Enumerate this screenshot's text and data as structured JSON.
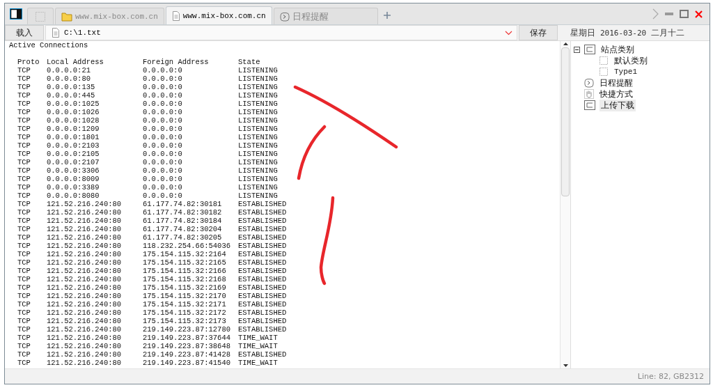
{
  "tabs": [
    {
      "kind": "blank",
      "selected": false
    },
    {
      "kind": "folder",
      "label": "www.mix-box.com.cn",
      "selected": false
    },
    {
      "kind": "document",
      "label": "www.mix-box.com.cn",
      "selected": true
    },
    {
      "kind": "clock",
      "label": "日程提醒",
      "selected": false
    }
  ],
  "toolbar": {
    "load_button": "载入",
    "path_value": "C:\\1.txt",
    "save_button": "保存"
  },
  "date_bar": {
    "weekday": "星期日",
    "date": "2016-03-20",
    "lunar_date": "二月十二"
  },
  "document": {
    "heading": "Active Connections",
    "columns": [
      "Proto",
      "Local Address",
      "Foreign Address",
      "State"
    ],
    "rows": [
      [
        "TCP",
        "0.0.0.0:21",
        "0.0.0.0:0",
        "LISTENING"
      ],
      [
        "TCP",
        "0.0.0.0:80",
        "0.0.0.0:0",
        "LISTENING"
      ],
      [
        "TCP",
        "0.0.0.0:135",
        "0.0.0.0:0",
        "LISTENING"
      ],
      [
        "TCP",
        "0.0.0.0:445",
        "0.0.0.0:0",
        "LISTENING"
      ],
      [
        "TCP",
        "0.0.0.0:1025",
        "0.0.0.0:0",
        "LISTENING"
      ],
      [
        "TCP",
        "0.0.0.0:1026",
        "0.0.0.0:0",
        "LISTENING"
      ],
      [
        "TCP",
        "0.0.0.0:1028",
        "0.0.0.0:0",
        "LISTENING"
      ],
      [
        "TCP",
        "0.0.0.0:1209",
        "0.0.0.0:0",
        "LISTENING"
      ],
      [
        "TCP",
        "0.0.0.0:1801",
        "0.0.0.0:0",
        "LISTENING"
      ],
      [
        "TCP",
        "0.0.0.0:2103",
        "0.0.0.0:0",
        "LISTENING"
      ],
      [
        "TCP",
        "0.0.0.0:2105",
        "0.0.0.0:0",
        "LISTENING"
      ],
      [
        "TCP",
        "0.0.0.0:2107",
        "0.0.0.0:0",
        "LISTENING"
      ],
      [
        "TCP",
        "0.0.0.0:3306",
        "0.0.0.0:0",
        "LISTENING"
      ],
      [
        "TCP",
        "0.0.0.0:8009",
        "0.0.0.0:0",
        "LISTENING"
      ],
      [
        "TCP",
        "0.0.0.0:3389",
        "0.0.0.0:0",
        "LISTENING"
      ],
      [
        "TCP",
        "0.0.0.0:8080",
        "0.0.0.0:0",
        "LISTENING"
      ],
      [
        "TCP",
        "121.52.216.240:80",
        "61.177.74.82:30181",
        "ESTABLISHED"
      ],
      [
        "TCP",
        "121.52.216.240:80",
        "61.177.74.82:30182",
        "ESTABLISHED"
      ],
      [
        "TCP",
        "121.52.216.240:80",
        "61.177.74.82:30184",
        "ESTABLISHED"
      ],
      [
        "TCP",
        "121.52.216.240:80",
        "61.177.74.82:30204",
        "ESTABLISHED"
      ],
      [
        "TCP",
        "121.52.216.240:80",
        "61.177.74.82:30205",
        "ESTABLISHED"
      ],
      [
        "TCP",
        "121.52.216.240:80",
        "118.232.254.66:54036",
        "ESTABLISHED"
      ],
      [
        "TCP",
        "121.52.216.240:80",
        "175.154.115.32:2164",
        "ESTABLISHED"
      ],
      [
        "TCP",
        "121.52.216.240:80",
        "175.154.115.32:2165",
        "ESTABLISHED"
      ],
      [
        "TCP",
        "121.52.216.240:80",
        "175.154.115.32:2166",
        "ESTABLISHED"
      ],
      [
        "TCP",
        "121.52.216.240:80",
        "175.154.115.32:2168",
        "ESTABLISHED"
      ],
      [
        "TCP",
        "121.52.216.240:80",
        "175.154.115.32:2169",
        "ESTABLISHED"
      ],
      [
        "TCP",
        "121.52.216.240:80",
        "175.154.115.32:2170",
        "ESTABLISHED"
      ],
      [
        "TCP",
        "121.52.216.240:80",
        "175.154.115.32:2171",
        "ESTABLISHED"
      ],
      [
        "TCP",
        "121.52.216.240:80",
        "175.154.115.32:2172",
        "ESTABLISHED"
      ],
      [
        "TCP",
        "121.52.216.240:80",
        "175.154.115.32:2173",
        "ESTABLISHED"
      ],
      [
        "TCP",
        "121.52.216.240:80",
        "219.149.223.87:12780",
        "ESTABLISHED"
      ],
      [
        "TCP",
        "121.52.216.240:80",
        "219.149.223.87:37644",
        "TIME_WAIT"
      ],
      [
        "TCP",
        "121.52.216.240:80",
        "219.149.223.87:38648",
        "TIME_WAIT"
      ],
      [
        "TCP",
        "121.52.216.240:80",
        "219.149.223.87:41428",
        "ESTABLISHED"
      ],
      [
        "TCP",
        "121.52.216.240:80",
        "219.149.223.87:41540",
        "TIME_WAIT"
      ]
    ]
  },
  "sidebar": {
    "items": [
      {
        "kind": "category",
        "label": "站点类别",
        "expanded": true,
        "selected": false,
        "children": [
          {
            "kind": "dotted",
            "label": "默认类别",
            "selected": false
          },
          {
            "kind": "dotted",
            "label": "Type1",
            "selected": false
          }
        ]
      },
      {
        "kind": "clock",
        "label": "日程提醒",
        "selected": false
      },
      {
        "kind": "hand",
        "label": "快捷方式",
        "selected": false
      },
      {
        "kind": "category",
        "label": "上传下载",
        "selected": true
      }
    ]
  },
  "status_bar": {
    "text": "Line: 82, GB2312"
  }
}
